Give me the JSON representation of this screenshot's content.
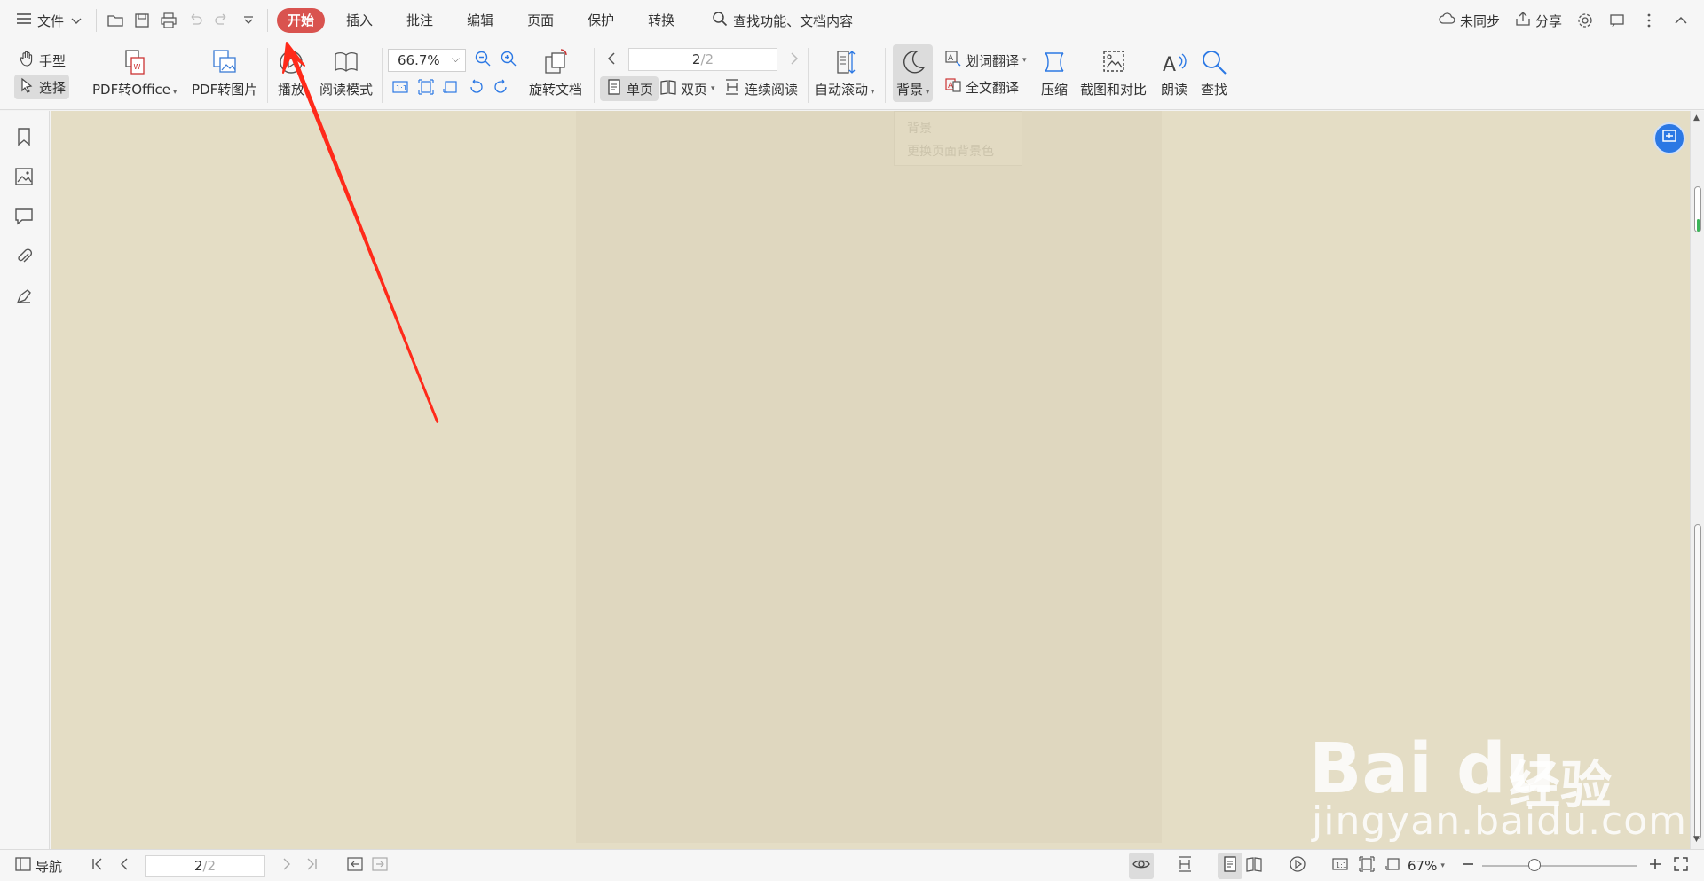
{
  "menubar": {
    "file_label": "文件",
    "tabs": [
      {
        "label": "开始",
        "active": true
      },
      {
        "label": "插入"
      },
      {
        "label": "批注"
      },
      {
        "label": "编辑"
      },
      {
        "label": "页面"
      },
      {
        "label": "保护"
      },
      {
        "label": "转换"
      }
    ],
    "search_label": "查找功能、文档内容",
    "sync_label": "未同步",
    "share_label": "分享"
  },
  "ribbon": {
    "hand_label": "手型",
    "select_label": "选择",
    "pdf_office_label": "PDF转Office",
    "pdf_image_label": "PDF转图片",
    "play_label": "播放",
    "read_mode_label": "阅读模式",
    "zoom_value": "66.7%",
    "rotate_label": "旋转文档",
    "page_current": "2",
    "page_total": "/2",
    "single_label": "单页",
    "double_label": "双页",
    "continuous_label": "连续阅读",
    "autoscroll_label": "自动滚动",
    "background_label": "背景",
    "word_translate_label": "划词翻译",
    "full_translate_label": "全文翻译",
    "compress_label": "压缩",
    "screenshot_label": "截图和对比",
    "read_aloud_label": "朗读",
    "find_label": "查找"
  },
  "dropdown": {
    "title": "背景",
    "desc": "更换页面背景色"
  },
  "statusbar": {
    "nav_label": "导航",
    "page_current": "2",
    "page_total": "/2",
    "zoom_value": "67%"
  },
  "watermark": {
    "logo": "Bai du",
    "cn": "经验",
    "url": "jingyan.baidu.com"
  },
  "colors": {
    "active_tab": "#d9534f",
    "doc_background": "#e4ddc5",
    "annotation_arrow": "#ff2a1a"
  }
}
